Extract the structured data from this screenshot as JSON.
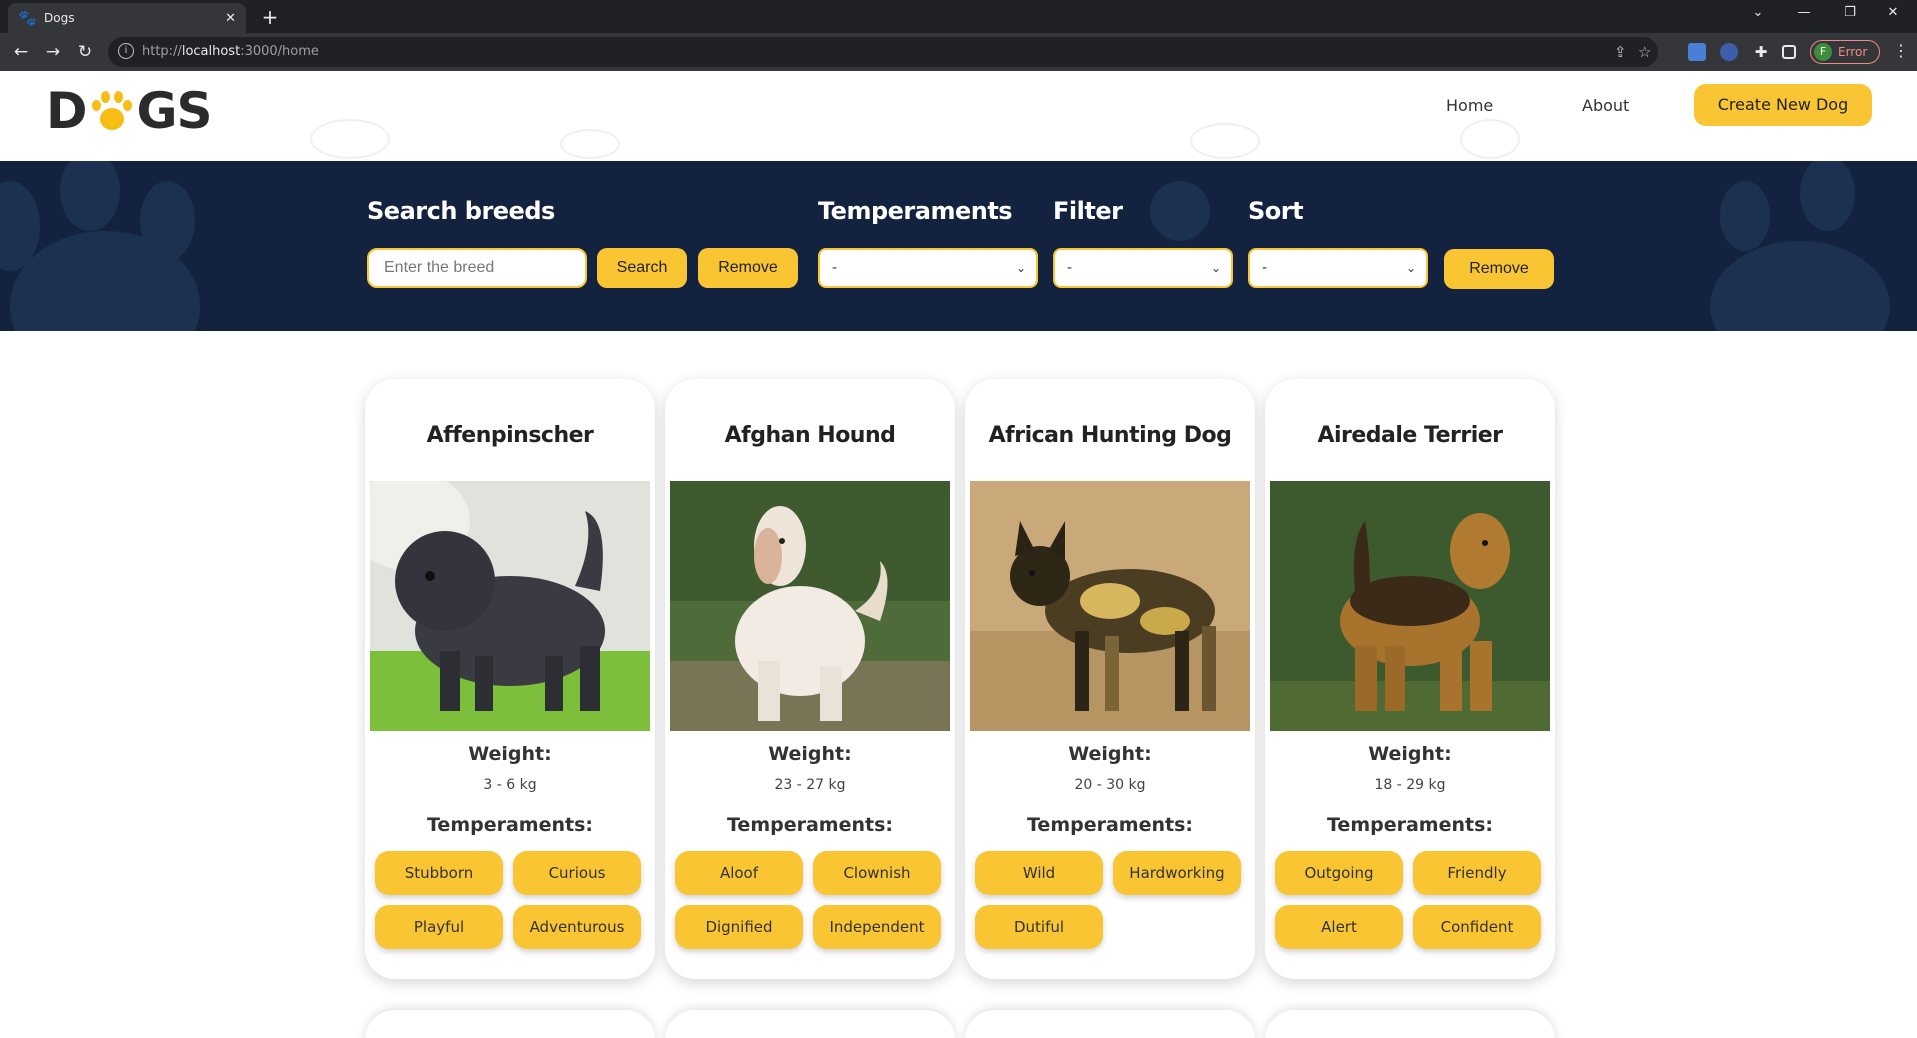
{
  "browser": {
    "tab_title": "Dogs",
    "url_prefix": "http://",
    "url_host": "localhost",
    "url_path": ":3000/home",
    "profile_initial": "F",
    "profile_status": "Error"
  },
  "header": {
    "logo_left": "D",
    "logo_right": "GS",
    "nav": {
      "home": "Home",
      "about": "About"
    },
    "create_label": "Create New Dog"
  },
  "search": {
    "search_label": "Search breeds",
    "placeholder": "Enter the breed",
    "search_btn": "Search",
    "remove_btn": "Remove",
    "temperaments_label": "Temperaments",
    "temperaments_value": "-",
    "filter_label": "Filter",
    "filter_value": "-",
    "sort_label": "Sort",
    "sort_value": "-",
    "remove_btn2": "Remove"
  },
  "cards": [
    {
      "name": "Affenpinscher",
      "weight_label": "Weight:",
      "weight": "3 - 6 kg",
      "temperaments_label": "Temperaments:",
      "temperaments": [
        "Stubborn",
        "Curious",
        "Playful",
        "Adventurous"
      ]
    },
    {
      "name": "Afghan Hound",
      "weight_label": "Weight:",
      "weight": "23 - 27 kg",
      "temperaments_label": "Temperaments:",
      "temperaments": [
        "Aloof",
        "Clownish",
        "Dignified",
        "Independent"
      ]
    },
    {
      "name": "African Hunting Dog",
      "weight_label": "Weight:",
      "weight": "20 - 30 kg",
      "temperaments_label": "Temperaments:",
      "temperaments": [
        "Wild",
        "Hardworking",
        "Dutiful"
      ]
    },
    {
      "name": "Airedale Terrier",
      "weight_label": "Weight:",
      "weight": "18 - 29 kg",
      "temperaments_label": "Temperaments:",
      "temperaments": [
        "Outgoing",
        "Friendly",
        "Alert",
        "Confident"
      ]
    }
  ],
  "colors": {
    "accent": "#f9c532",
    "navy": "#13233f",
    "text": "#222222"
  }
}
